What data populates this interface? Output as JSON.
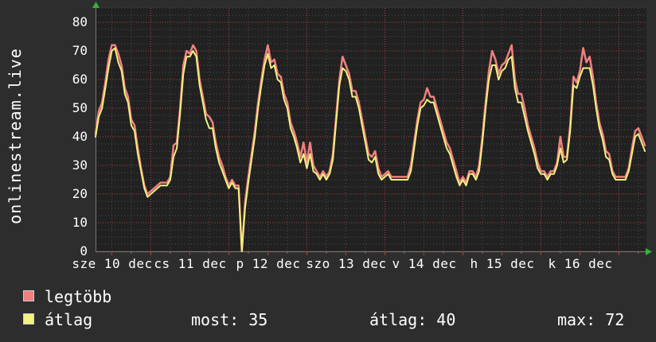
{
  "title": "onlinestream.live",
  "legend": {
    "items": [
      {
        "label": "legtöbb",
        "color": "#f08080"
      },
      {
        "label": "átlag",
        "color": "#f1f17e"
      }
    ],
    "stats": [
      {
        "text": "most: 35"
      },
      {
        "text": "átlag: 40"
      },
      {
        "text": "max: 72"
      }
    ]
  },
  "colors": {
    "outer_background": "#2d2d2d",
    "plot_background": "#212121",
    "major_grid": "#aa4343",
    "minor_grid": "#4e4e4e",
    "axis": "#7a7a7a",
    "arrow": "#36b336",
    "text": "#ffffff",
    "series_max": "#f08080",
    "series_avg": "#f1f17e"
  },
  "chart_data": {
    "type": "line",
    "title": "onlinestream.live",
    "ylim": [
      0,
      85
    ],
    "y_ticks": [
      0,
      10,
      20,
      30,
      40,
      50,
      60,
      70,
      80
    ],
    "x_tick_labels": [
      "sze 10 dec",
      "cs 11 dec",
      "p 12 dec",
      "szo 13 dec",
      "v 14 dec",
      "h 15 dec",
      "k 16 dec"
    ],
    "x_hours_per_point": 1,
    "x_first_day_boundary_hour": 17,
    "grid": {
      "minor_y": 2.5,
      "major_y": 10,
      "minor_x_hours": 6,
      "major_x_hours": 24
    },
    "legend_position": "bottom-left",
    "stats": {
      "most": 35,
      "átlag": 40,
      "max": 72
    },
    "series": [
      {
        "name": "legtöbb",
        "color": "#f08080",
        "values": [
          41,
          49,
          52,
          59,
          67,
          72,
          72,
          69,
          65,
          57,
          54,
          46,
          44,
          36,
          29,
          23,
          20,
          21,
          22,
          23,
          24,
          24,
          24,
          26,
          37,
          38,
          50,
          65,
          70,
          69,
          72,
          70,
          60,
          54,
          48,
          47,
          45,
          38,
          33,
          30,
          26,
          23,
          25,
          23,
          23,
          0,
          17,
          26,
          34,
          42,
          52,
          60,
          67,
          72,
          66,
          67,
          62,
          61,
          55,
          52,
          45,
          42,
          38,
          33,
          38,
          31,
          38,
          30,
          28,
          26,
          28,
          26,
          28,
          34,
          47,
          60,
          68,
          65,
          62,
          56,
          56,
          52,
          46,
          40,
          34,
          33,
          35,
          29,
          26,
          27,
          28,
          26,
          26,
          26,
          26,
          26,
          26,
          30,
          38,
          46,
          52,
          53,
          57,
          54,
          54,
          50,
          46,
          42,
          38,
          36,
          32,
          28,
          24,
          26,
          24,
          28,
          28,
          26,
          30,
          40,
          52,
          63,
          70,
          67,
          62,
          65,
          66,
          69,
          72,
          60,
          55,
          55,
          50,
          44,
          40,
          36,
          31,
          28,
          28,
          26,
          28,
          28,
          31,
          40,
          33,
          33,
          44,
          61,
          59,
          63,
          71,
          66,
          68,
          61,
          52,
          45,
          41,
          35,
          34,
          28,
          26,
          26,
          26,
          26,
          29,
          36,
          42,
          43,
          40,
          37
        ]
      },
      {
        "name": "átlag",
        "color": "#f1f17e",
        "values": [
          40,
          47,
          50,
          57,
          64,
          70,
          71,
          66,
          63,
          55,
          52,
          44,
          42,
          34,
          28,
          22,
          19,
          20,
          21,
          22,
          23,
          23,
          23,
          25,
          33,
          36,
          48,
          62,
          68,
          68,
          70,
          68,
          58,
          52,
          46,
          43,
          43,
          36,
          31,
          28,
          25,
          22,
          24,
          22,
          22,
          0,
          15,
          24,
          32,
          40,
          50,
          58,
          65,
          69,
          64,
          65,
          60,
          59,
          53,
          50,
          43,
          40,
          36,
          31,
          34,
          29,
          34,
          28,
          27,
          25,
          27,
          25,
          27,
          32,
          45,
          58,
          64,
          63,
          60,
          54,
          54,
          50,
          44,
          38,
          32,
          31,
          33,
          27,
          25,
          26,
          27,
          25,
          25,
          25,
          25,
          25,
          25,
          28,
          36,
          44,
          50,
          51,
          53,
          52,
          52,
          48,
          44,
          40,
          36,
          34,
          30,
          26,
          23,
          25,
          23,
          27,
          27,
          25,
          28,
          38,
          50,
          60,
          65,
          65,
          60,
          63,
          64,
          67,
          68,
          57,
          52,
          52,
          47,
          42,
          38,
          34,
          29,
          27,
          27,
          25,
          27,
          27,
          30,
          36,
          31,
          32,
          42,
          58,
          57,
          61,
          64,
          64,
          64,
          58,
          50,
          43,
          39,
          33,
          32,
          27,
          25,
          25,
          25,
          25,
          28,
          34,
          40,
          41,
          38,
          35
        ]
      }
    ]
  }
}
